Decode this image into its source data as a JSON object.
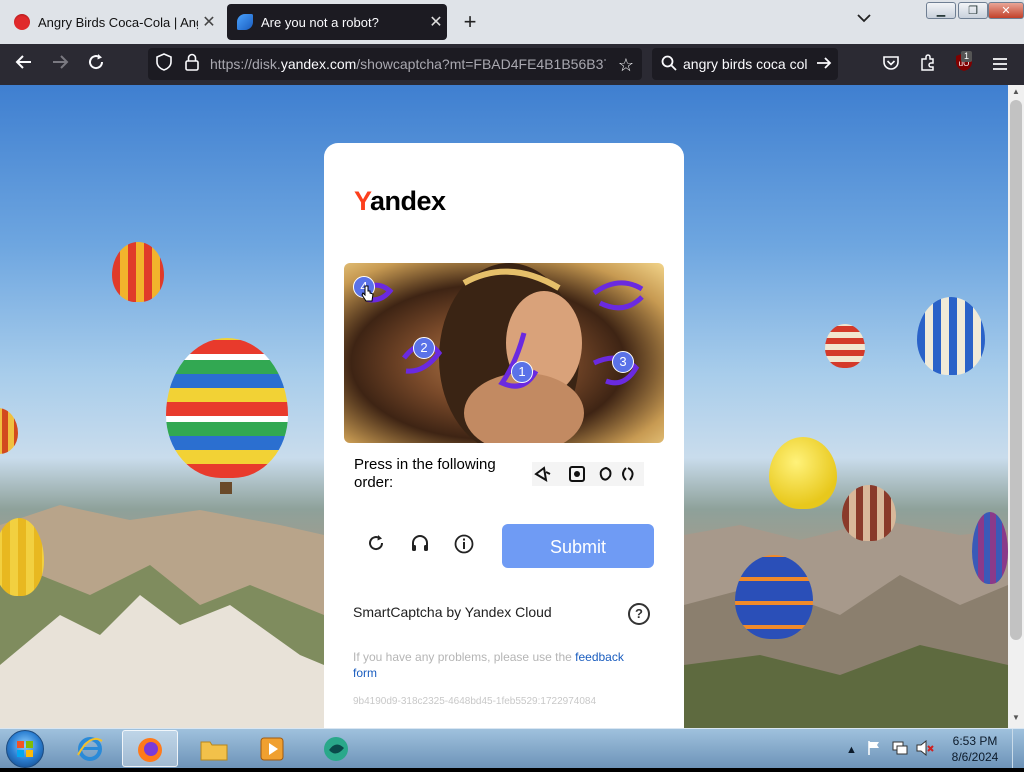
{
  "browser": {
    "tabs": [
      {
        "title": "Angry Birds Coca-Cola | Angry"
      },
      {
        "title": "Are you not a robot?"
      }
    ],
    "url_prefix": "https://disk.",
    "url_domain": "yandex.com",
    "url_suffix": "/showcaptcha?mt=FBAD4FE4B1B56B37(",
    "search_query": "angry birds coca col",
    "extension_badge": "1"
  },
  "captcha": {
    "logo_first": "Y",
    "logo_rest": "andex",
    "badges": [
      "4",
      "2",
      "1",
      "3"
    ],
    "order_label": "Press in the following order:",
    "submit_label": "Submit",
    "brand": "SmartCaptcha by Yandex Cloud",
    "help_glyph": "?",
    "problems_text": "If you have any problems, please use the ",
    "feedback_link": "feedback form",
    "token": "9b4190d9-318c2325-4648bd45-1feb5529:1722974084"
  },
  "taskbar": {
    "time": "6:53 PM",
    "date": "8/6/2024"
  },
  "colors": {
    "accent": "#6f9bf4",
    "yandex_red": "#fc3f1d",
    "badge": "#5a72e8"
  }
}
